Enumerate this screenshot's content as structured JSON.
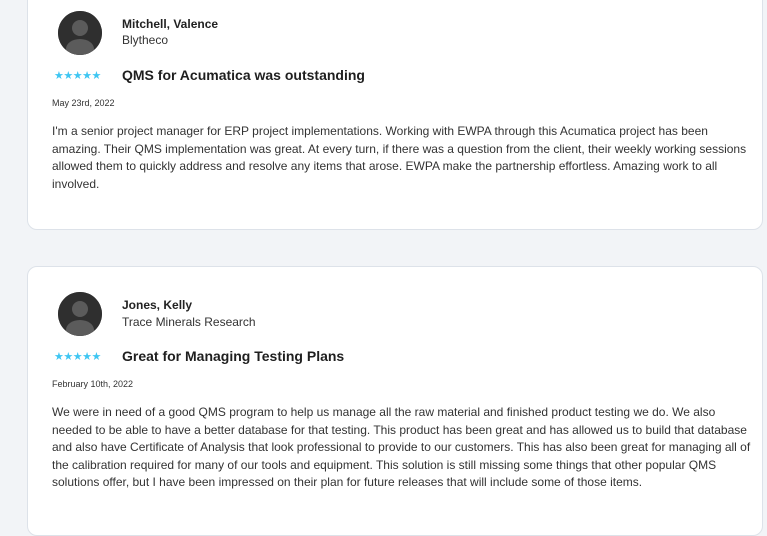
{
  "theme": {
    "star_color": "#3ec6f2",
    "avatar_color": "#2f2f2f",
    "card_border": "#dde2e9",
    "page_background": "#f2f4f7"
  },
  "reviews": [
    {
      "reviewer_name": "Mitchell, Valence",
      "company": "Blytheco",
      "rating": 5,
      "stars": "★★★★★",
      "title": "QMS for Acumatica was outstanding",
      "date": "May 23rd, 2022",
      "body": "I'm a senior project manager for ERP project implementations. Working with EWPA through this Acumatica project has been amazing. Their QMS implementation was great. At every turn, if there was a question from the client, their weekly working sessions allowed them to quickly address and resolve any items that arose. EWPA make the partnership effortless. Amazing work to all involved."
    },
    {
      "reviewer_name": "Jones, Kelly",
      "company": "Trace Minerals Research",
      "rating": 5,
      "stars": "★★★★★",
      "title": "Great for Managing Testing Plans",
      "date": "February 10th, 2022",
      "body": "We were in need of a good QMS program to help us manage all the raw material and finished product testing we do. We also needed to be able to have a better database for that testing. This product has been great and has allowed us to build that database and also have Certificate of Analysis that look professional to provide to our customers. This has also been great for managing all of the calibration required for many of our tools and equipment. This solution is still missing some things that other popular QMS solutions offer, but I have been impressed on their plan for future releases that will include some of those items."
    }
  ]
}
